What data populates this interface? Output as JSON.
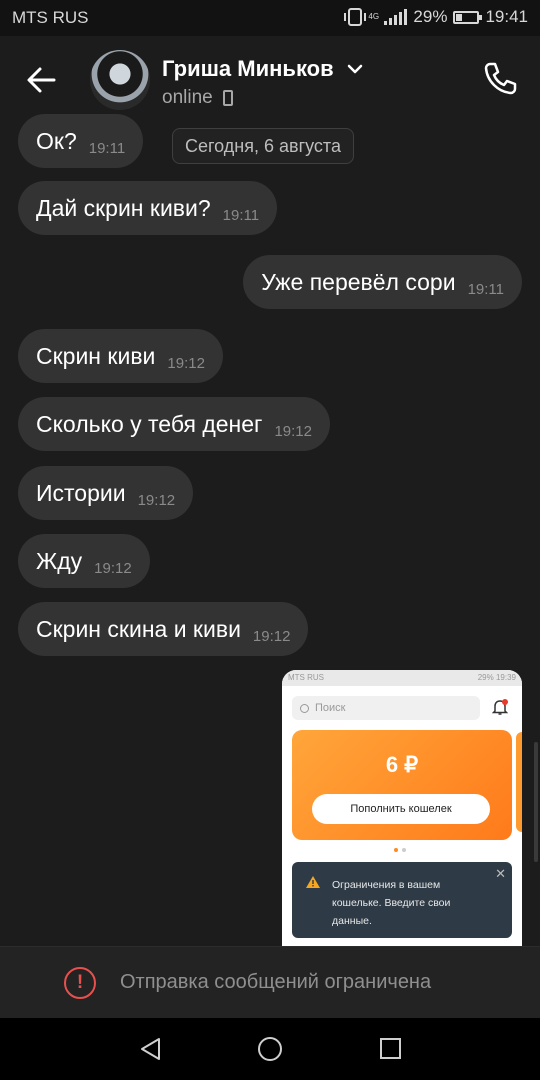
{
  "status_bar": {
    "carrier": "MTS RUS",
    "network": "4G",
    "battery": "29%",
    "battery_level": 0.29,
    "time": "19:41"
  },
  "header": {
    "contact_name": "Гриша Миньков",
    "status": "online",
    "icons": [
      "back-arrow-icon",
      "chevron-down-icon",
      "mobile-device-icon",
      "phone-icon"
    ]
  },
  "date_separator": "Сегодня, 6 августа",
  "messages": [
    {
      "text": "Ок?",
      "time": "19:11",
      "direction": "incoming"
    },
    {
      "text": "Дай скрин киви?",
      "time": "19:11",
      "direction": "incoming"
    },
    {
      "text": "Уже перевёл сори",
      "time": "19:11",
      "direction": "outgoing"
    },
    {
      "text": "Скрин киви",
      "time": "19:12",
      "direction": "incoming"
    },
    {
      "text": "Сколько у тебя денег",
      "time": "19:12",
      "direction": "incoming"
    },
    {
      "text": "Истории",
      "time": "19:12",
      "direction": "incoming"
    },
    {
      "text": "Жду",
      "time": "19:12",
      "direction": "incoming"
    },
    {
      "text": "Скрин скина и киви",
      "time": "19:12",
      "direction": "incoming"
    }
  ],
  "image_message": {
    "status_carrier": "MTS RUS",
    "status_right": "29% 19:39",
    "search_placeholder": "Поиск",
    "wallet_amount": "6 ₽",
    "topup_button": "Пополнить кошелек",
    "alert_text": "Ограничения в вашем кошельке. Введите свои данные.",
    "alert_close": "✕",
    "accent_color": "#ff8a1f"
  },
  "restricted_bar": {
    "icon": "!",
    "text": "Отправка сообщений ограничена",
    "color": "#e8504d"
  }
}
